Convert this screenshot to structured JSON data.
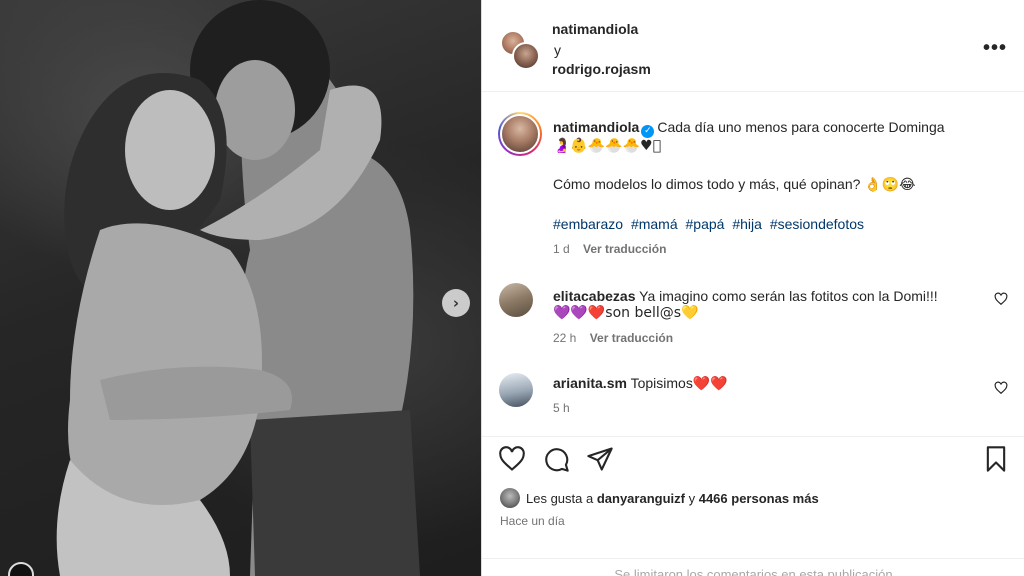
{
  "post": {
    "header": {
      "author1": "natimandiola",
      "conjunction": "y",
      "author2": "rodrigo.rojasm",
      "more_label": "•••"
    },
    "caption": {
      "username": "natimandiola",
      "verified_mark": "✓",
      "text": "Cada día uno menos para conocerte Dominga",
      "emoji_line": "🤰👶🐣🐣🐣♥⃞",
      "line2": "Cómo modelos lo dimos todo y más, qué opinan? 👌🙄😂",
      "hashtags": [
        "#embarazo",
        "#mamá",
        "#papá",
        "#hija",
        "#sesiondefotos"
      ],
      "age": "1 d",
      "translate": "Ver traducción"
    },
    "comments": [
      {
        "username": "elitacabezas",
        "text": "Ya imagino como serán las fotitos con la Domi!!!",
        "text2": "💜💜❤️son bell@s💛",
        "age": "22 h",
        "translate": "Ver traducción"
      },
      {
        "username": "arianita.sm",
        "text": "Topisimos❤️❤️",
        "age": "5 h"
      }
    ],
    "likes": {
      "prefix": "Les gusta a",
      "user": "danyaranguizf",
      "mid": "y",
      "count": "4466 personas más"
    },
    "posted": "Hace un día",
    "footer": "Se limitaron los comentarios en esta publicación"
  },
  "icons": {
    "next": "chevron-right-icon",
    "like": "heart-icon",
    "comment": "comment-icon",
    "share": "share-icon",
    "save": "bookmark-icon"
  },
  "colors": {
    "hashtag": "#00376b",
    "verified": "#0095f6",
    "muted": "#737373"
  }
}
